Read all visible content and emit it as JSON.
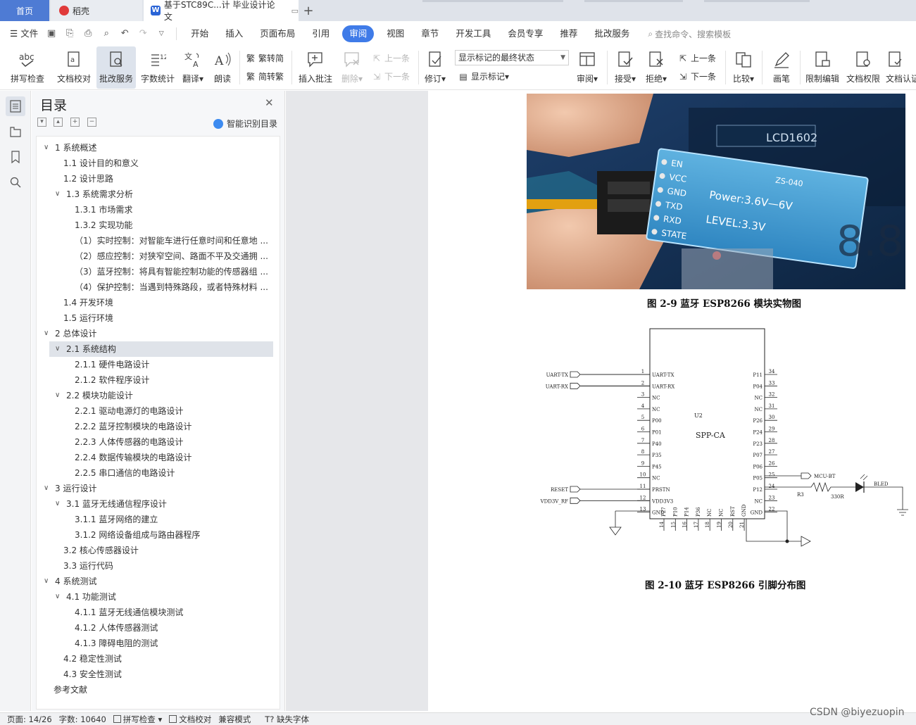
{
  "tabs": {
    "home": "首页",
    "daoke": "稻壳",
    "doc": "基于STC89C...计 毕业设计论文",
    "add": "+"
  },
  "menubar": {
    "file": "文件",
    "items": [
      "开始",
      "插入",
      "页面布局",
      "引用",
      "审阅",
      "视图",
      "章节",
      "开发工具",
      "会员专享",
      "推荐",
      "批改服务"
    ],
    "active": "审阅",
    "search": "查找命令、搜索模板"
  },
  "ribbon": {
    "spell": "拼写检查",
    "doc_check": "文档校对",
    "correction": "批改服务",
    "word_count": "字数统计",
    "translate": "翻译",
    "read": "朗读",
    "to_trad": "繁转简",
    "to_simp": "简转繁",
    "insert_comment": "插入批注",
    "delete": "删除",
    "prev": "上一条",
    "next": "下一条",
    "revise": "修订",
    "markup_state": "显示标记的最终状态",
    "show_markup": "显示标记",
    "review": "审阅",
    "accept": "接受",
    "reject": "拒绝",
    "prev2": "上一条",
    "next2": "下一条",
    "compare": "比较",
    "pen": "画笔",
    "restrict": "限制编辑",
    "doc_perm": "文档权限",
    "doc_auth": "文档认证"
  },
  "outline": {
    "title": "目录",
    "smart_toc": "智能识别目录",
    "items": [
      {
        "text": "1  系统概述",
        "level": 1,
        "chev": "v"
      },
      {
        "text": "1.1  设计目的和意义",
        "level": 2,
        "chev": ""
      },
      {
        "text": "1.2  设计思路",
        "level": 2,
        "chev": ""
      },
      {
        "text": "1.3  系统需求分析",
        "level": 2,
        "chev": "v"
      },
      {
        "text": "1.3.1 市场需求",
        "level": 3,
        "chev": ""
      },
      {
        "text": "1.3.2 实现功能",
        "level": 3,
        "chev": ""
      },
      {
        "text": "（1）实时控制：对智能车进行任意时间和任意地 ...",
        "level": 3,
        "chev": ""
      },
      {
        "text": "（2）感应控制：对狭窄空间、路面不平及交通拥 ...",
        "level": 3,
        "chev": ""
      },
      {
        "text": "（3）蓝牙控制：将具有智能控制功能的传感器组 ...",
        "level": 3,
        "chev": ""
      },
      {
        "text": "（4）保护控制：当遇到特殊路段，或者特殊材料 ...",
        "level": 3,
        "chev": ""
      },
      {
        "text": "1.4  开发环境",
        "level": 2,
        "chev": ""
      },
      {
        "text": "1.5  运行环境",
        "level": 2,
        "chev": ""
      },
      {
        "text": "2  总体设计",
        "level": 1,
        "chev": "v"
      },
      {
        "text": "2.1  系统结构",
        "level": 2,
        "chev": "v",
        "selected": true
      },
      {
        "text": "2.1.1  硬件电路设计",
        "level": 3,
        "chev": ""
      },
      {
        "text": "2.1.2  软件程序设计",
        "level": 3,
        "chev": ""
      },
      {
        "text": "2.2  模块功能设计",
        "level": 2,
        "chev": "v"
      },
      {
        "text": "2.2.1  驱动电源灯的电路设计",
        "level": 3,
        "chev": ""
      },
      {
        "text": "2.2.2  蓝牙控制模块的电路设计",
        "level": 3,
        "chev": ""
      },
      {
        "text": "2.2.3  人体传感器的电路设计",
        "level": 3,
        "chev": ""
      },
      {
        "text": "2.2.4  数据传输模块的电路设计",
        "level": 3,
        "chev": ""
      },
      {
        "text": "2.2.5  串口通信的电路设计",
        "level": 3,
        "chev": ""
      },
      {
        "text": "3  运行设计",
        "level": 1,
        "chev": "v"
      },
      {
        "text": "3.1    蓝牙无线通信程序设计",
        "level": 2,
        "chev": "v"
      },
      {
        "text": "3.1.1  蓝牙网络的建立",
        "level": 3,
        "chev": ""
      },
      {
        "text": "3.1.2  网络设备组成与路由器程序",
        "level": 3,
        "chev": ""
      },
      {
        "text": "3.2  核心传感器设计",
        "level": 2,
        "chev": ""
      },
      {
        "text": "3.3  运行代码",
        "level": 2,
        "chev": ""
      },
      {
        "text": "4  系统测试",
        "level": 1,
        "chev": "v"
      },
      {
        "text": "4.1  功能测试",
        "level": 2,
        "chev": "v"
      },
      {
        "text": "4.1.1  蓝牙无线通信模块测试",
        "level": 3,
        "chev": ""
      },
      {
        "text": "4.1.2  人体传感器测试",
        "level": 3,
        "chev": ""
      },
      {
        "text": "4.1.3  障碍电阻的测试",
        "level": 3,
        "chev": ""
      },
      {
        "text": "4.2  稳定性测试",
        "level": 2,
        "chev": ""
      },
      {
        "text": "4.3  安全性测试",
        "level": 2,
        "chev": ""
      },
      {
        "text": "参考文献",
        "level": 1,
        "chev": "",
        "noindent": true
      }
    ]
  },
  "document": {
    "caption1": "图 2-9     蓝牙 ESP8266 模块实物图",
    "caption2": "图 2-10     蓝牙 ESP8266 引脚分布图",
    "photo_labels": {
      "module": "ZS-040",
      "power": "Power:3.6V—6V",
      "level": "LEVEL:3.3V",
      "pins": [
        "EN",
        "VCC",
        "GND",
        "TXD",
        "RXD",
        "STATE"
      ],
      "lcd": "LCD1602"
    },
    "schematic": {
      "chip_ref": "U2",
      "chip_name": "SPP-CA",
      "left_pins": [
        {
          "num": "1",
          "name": "UART-TX",
          "net": "UART-TX"
        },
        {
          "num": "2",
          "name": "UART-RX",
          "net": "UART-RX"
        },
        {
          "num": "3",
          "name": "NC",
          "net": ""
        },
        {
          "num": "4",
          "name": "NC",
          "net": ""
        },
        {
          "num": "5",
          "name": "P00",
          "net": ""
        },
        {
          "num": "6",
          "name": "P01",
          "net": ""
        },
        {
          "num": "7",
          "name": "P40",
          "net": ""
        },
        {
          "num": "8",
          "name": "P35",
          "net": ""
        },
        {
          "num": "9",
          "name": "P45",
          "net": ""
        },
        {
          "num": "10",
          "name": "NC",
          "net": ""
        },
        {
          "num": "11",
          "name": "PRSTN",
          "net": "RESET"
        },
        {
          "num": "12",
          "name": "VDD3V3",
          "net": "VDD3V_RF"
        },
        {
          "num": "13",
          "name": "GND",
          "net": ""
        }
      ],
      "right_pins": [
        {
          "num": "34",
          "name": "P11"
        },
        {
          "num": "33",
          "name": "P04"
        },
        {
          "num": "32",
          "name": "NC"
        },
        {
          "num": "31",
          "name": "NC"
        },
        {
          "num": "30",
          "name": "P26"
        },
        {
          "num": "29",
          "name": "P24"
        },
        {
          "num": "28",
          "name": "P23"
        },
        {
          "num": "27",
          "name": "P07"
        },
        {
          "num": "26",
          "name": "P06"
        },
        {
          "num": "25",
          "name": "P05"
        },
        {
          "num": "24",
          "name": "P12"
        },
        {
          "num": "23",
          "name": "NC"
        },
        {
          "num": "22",
          "name": "GND"
        }
      ],
      "bottom_pins": [
        {
          "num": "14",
          "name": "P27"
        },
        {
          "num": "15",
          "name": "P10"
        },
        {
          "num": "16",
          "name": "P14"
        },
        {
          "num": "17",
          "name": "P36"
        },
        {
          "num": "18",
          "name": "NC"
        },
        {
          "num": "19",
          "name": "NC"
        },
        {
          "num": "20",
          "name": "RST"
        },
        {
          "num": "21",
          "name": "GND"
        }
      ],
      "mcu_bt": "MCU-BT",
      "r3": "R3",
      "r3_val": "330R",
      "led": "BLED"
    }
  },
  "status": {
    "page": "页面: 14/26",
    "words": "字数: 10640",
    "spell": "拼写检查",
    "doc_check": "文档校对",
    "compat": "兼容模式",
    "missing_font": "缺失字体"
  },
  "watermark": "CSDN @biyezuopin"
}
